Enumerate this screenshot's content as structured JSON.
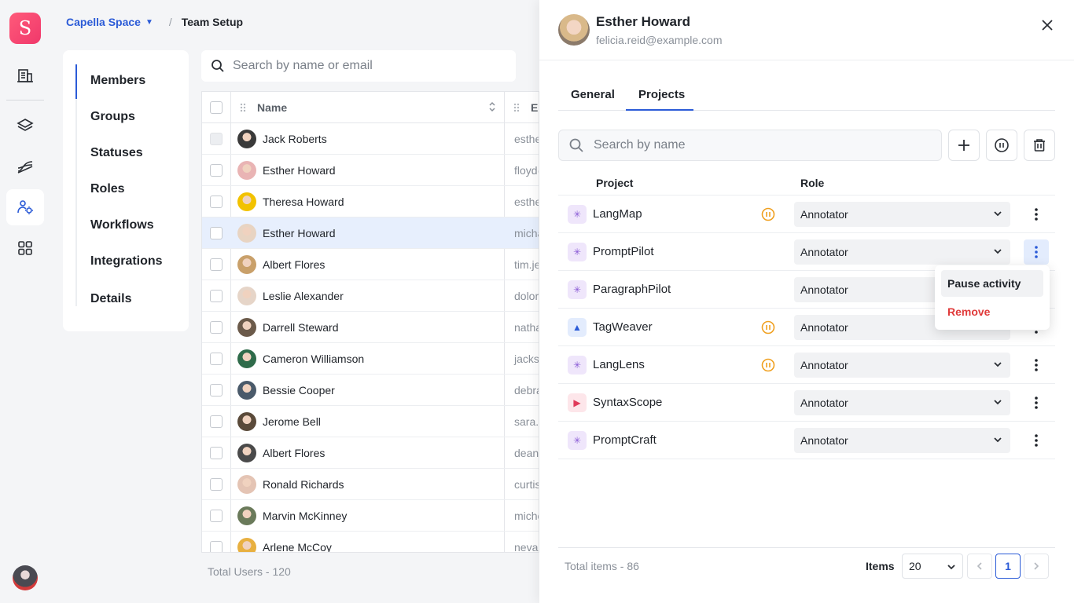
{
  "app": {
    "logo_letter": "S"
  },
  "breadcrumb": {
    "workspace": "Capella Space",
    "page": "Team Setup"
  },
  "subnav": {
    "items": [
      "Members",
      "Groups",
      "Statuses",
      "Roles",
      "Workflows",
      "Integrations",
      "Details"
    ],
    "active": "Members"
  },
  "members": {
    "search_placeholder": "Search by name or email",
    "columns": {
      "name": "Name",
      "email": "Email"
    },
    "rows": [
      {
        "name": "Jack Roberts",
        "email": "esther@example.com"
      },
      {
        "name": "Esther Howard",
        "email": "floyd@example.com"
      },
      {
        "name": "Theresa Howard",
        "email": "esther@example.com"
      },
      {
        "name": "Esther Howard",
        "email": "michael@example.com",
        "selected": true
      },
      {
        "name": "Albert Flores",
        "email": "tim.jennings@example.com"
      },
      {
        "name": "Leslie Alexander",
        "email": "dolores@example.com"
      },
      {
        "name": "Darrell Steward",
        "email": "nathan@example.com"
      },
      {
        "name": "Cameron Williamson",
        "email": "jackson@example.com"
      },
      {
        "name": "Bessie Cooper",
        "email": "debra@example.com"
      },
      {
        "name": "Jerome Bell",
        "email": "sara.cruz@example.com"
      },
      {
        "name": "Albert Flores",
        "email": "deanna@example.com"
      },
      {
        "name": "Ronald Richards",
        "email": "curtis@example.com"
      },
      {
        "name": "Marvin McKinney",
        "email": "michelle@example.com"
      },
      {
        "name": "Arlene McCoy",
        "email": "nevaeh@example.com"
      }
    ],
    "total_label": "Total Users - 120"
  },
  "panel": {
    "user_name": "Esther Howard",
    "user_email": "felicia.reid@example.com",
    "tabs": [
      "General",
      "Projects"
    ],
    "active_tab": "Projects",
    "search_placeholder": "Search by name",
    "col_project": "Project",
    "col_role": "Role",
    "projects": [
      {
        "name": "LangMap",
        "role": "Annotator",
        "paused": true,
        "icon": "sparkle-icon"
      },
      {
        "name": "PromptPilot",
        "role": "Annotator",
        "paused": false,
        "icon": "sparkle-icon"
      },
      {
        "name": "ParagraphPilot",
        "role": "Annotator",
        "paused": false,
        "icon": "sparkle-icon"
      },
      {
        "name": "TagWeaver",
        "role": "Annotator",
        "paused": true,
        "icon": "image-icon"
      },
      {
        "name": "LangLens",
        "role": "Annotator",
        "paused": true,
        "icon": "sparkle-icon"
      },
      {
        "name": "SyntaxScope",
        "role": "Annotator",
        "paused": false,
        "icon": "video-icon"
      },
      {
        "name": "PromptCraft",
        "role": "Annotator",
        "paused": false,
        "icon": "sparkle-icon"
      }
    ],
    "context_menu": {
      "pause": "Pause activity",
      "remove": "Remove"
    },
    "total_items": "Total items - 86",
    "items_label": "Items",
    "items_per_page": "20",
    "current_page": "1"
  },
  "colors": {
    "accent": "#2b5bd7",
    "danger": "#e03a3a",
    "paused": "#f0a020",
    "brand": "#f0386b"
  }
}
